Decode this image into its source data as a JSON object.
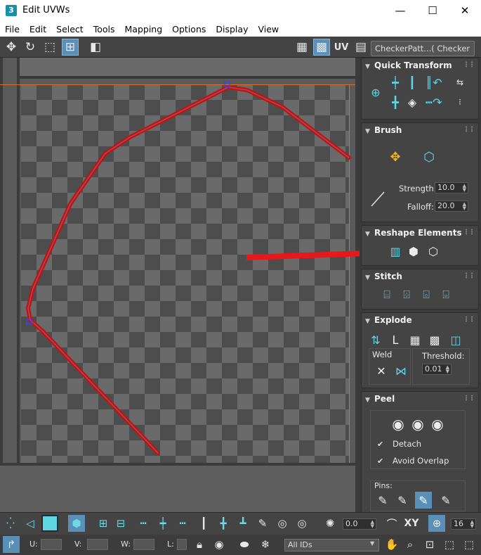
{
  "window": {
    "app_icon": "3",
    "title": "Edit UVWs",
    "minimize": "—",
    "maximize": "☐",
    "close": "✕"
  },
  "menu": [
    "File",
    "Edit",
    "Select",
    "Tools",
    "Mapping",
    "Options",
    "Display",
    "View"
  ],
  "toolbar": {
    "uv_label": "UV",
    "texture_select": "CheckerPatt...( Checker )"
  },
  "panel": {
    "quick_transform": "Quick Transform",
    "brush": {
      "title": "Brush",
      "strength_label": "Strength:",
      "strength_value": "10.0",
      "falloff_label": "Falloff:",
      "falloff_value": "20.0"
    },
    "reshape": "Reshape Elements",
    "stitch": "Stitch",
    "explode": {
      "title": "Explode",
      "weld_label": "Weld",
      "threshold_label": "Threshold:",
      "threshold_value": "0.01"
    },
    "peel": {
      "title": "Peel",
      "detach_label": "Detach",
      "avoid_overlap_label": "Avoid Overlap",
      "pins_label": "Pins:"
    }
  },
  "bottom": {
    "xy_label": "XY",
    "angle_value": "0.0",
    "grid_value": "16",
    "u_label": "U:",
    "v_label": "V:",
    "w_label": "W:",
    "l_label": "L:",
    "ids_select": "All IDs"
  },
  "colors": {
    "uv_line": "#b0191e",
    "arrow": "#e8171b",
    "accent": "#5ed7e4"
  }
}
